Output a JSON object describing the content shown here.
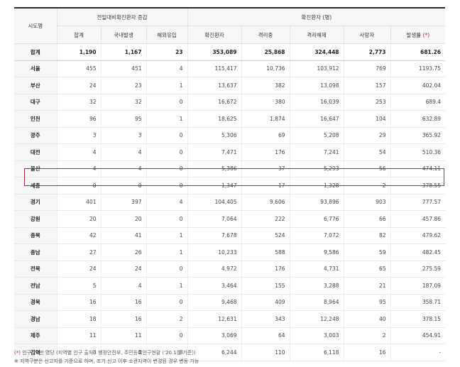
{
  "header": {
    "region_col": "시도명",
    "group_daily": "전일대비확진환자 증감",
    "group_confirmed": "확진환자 (명)",
    "daily_cols": [
      "합계",
      "국내발생",
      "해외유입"
    ],
    "confirmed_cols": [
      "확진환자",
      "격리중",
      "격리해제",
      "사망자"
    ],
    "incidence_col": "발생률",
    "incidence_mark": "(*)"
  },
  "rows": [
    {
      "region": "합계",
      "total": "1,190",
      "domestic": "1,167",
      "imported": "23",
      "confirmed": "353,089",
      "isolated": "25,868",
      "released": "324,448",
      "deaths": "2,773",
      "incidence": "681.26"
    },
    {
      "region": "서울",
      "total": "455",
      "domestic": "451",
      "imported": "4",
      "confirmed": "115,417",
      "isolated": "10,736",
      "released": "103,912",
      "deaths": "769",
      "incidence": "1193.75"
    },
    {
      "region": "부산",
      "total": "24",
      "domestic": "23",
      "imported": "1",
      "confirmed": "13,637",
      "isolated": "382",
      "released": "13,098",
      "deaths": "157",
      "incidence": "402.04"
    },
    {
      "region": "대구",
      "total": "32",
      "domestic": "32",
      "imported": "0",
      "confirmed": "16,672",
      "isolated": "380",
      "released": "16,039",
      "deaths": "253",
      "incidence": "689.4"
    },
    {
      "region": "인천",
      "total": "96",
      "domestic": "95",
      "imported": "1",
      "confirmed": "18,625",
      "isolated": "1,874",
      "released": "16,647",
      "deaths": "104",
      "incidence": "632.89"
    },
    {
      "region": "광주",
      "total": "3",
      "domestic": "3",
      "imported": "0",
      "confirmed": "5,306",
      "isolated": "69",
      "released": "5,208",
      "deaths": "29",
      "incidence": "365.92"
    },
    {
      "region": "대전",
      "total": "4",
      "domestic": "4",
      "imported": "0",
      "confirmed": "7,471",
      "isolated": "176",
      "released": "7,241",
      "deaths": "54",
      "incidence": "510.36"
    },
    {
      "region": "울산",
      "total": "4",
      "domestic": "4",
      "imported": "0",
      "confirmed": "5,386",
      "isolated": "37",
      "released": "5,293",
      "deaths": "56",
      "incidence": "474.11"
    },
    {
      "region": "세종",
      "total": "0",
      "domestic": "0",
      "imported": "0",
      "confirmed": "1,347",
      "isolated": "17",
      "released": "1,328",
      "deaths": "2",
      "incidence": "378.55"
    },
    {
      "region": "경기",
      "total": "401",
      "domestic": "397",
      "imported": "4",
      "confirmed": "104,405",
      "isolated": "9,606",
      "released": "93,896",
      "deaths": "903",
      "incidence": "777.57"
    },
    {
      "region": "강원",
      "total": "20",
      "domestic": "20",
      "imported": "0",
      "confirmed": "7,064",
      "isolated": "222",
      "released": "6,776",
      "deaths": "66",
      "incidence": "457.86"
    },
    {
      "region": "충북",
      "total": "42",
      "domestic": "41",
      "imported": "1",
      "confirmed": "7,678",
      "isolated": "524",
      "released": "7,072",
      "deaths": "82",
      "incidence": "479.62"
    },
    {
      "region": "충남",
      "total": "27",
      "domestic": "26",
      "imported": "1",
      "confirmed": "10,233",
      "isolated": "588",
      "released": "9,586",
      "deaths": "59",
      "incidence": "482.45"
    },
    {
      "region": "전북",
      "total": "24",
      "domestic": "24",
      "imported": "0",
      "confirmed": "4,972",
      "isolated": "176",
      "released": "4,731",
      "deaths": "65",
      "incidence": "275.59"
    },
    {
      "region": "전남",
      "total": "5",
      "domestic": "4",
      "imported": "1",
      "confirmed": "3,464",
      "isolated": "155",
      "released": "3,288",
      "deaths": "21",
      "incidence": "187.09"
    },
    {
      "region": "경북",
      "total": "16",
      "domestic": "16",
      "imported": "0",
      "confirmed": "9,468",
      "isolated": "409",
      "released": "8,964",
      "deaths": "95",
      "incidence": "358.71"
    },
    {
      "region": "경남",
      "total": "18",
      "domestic": "16",
      "imported": "2",
      "confirmed": "12,631",
      "isolated": "343",
      "released": "12,248",
      "deaths": "40",
      "incidence": "378.15"
    },
    {
      "region": "제주",
      "total": "11",
      "domestic": "11",
      "imported": "0",
      "confirmed": "3,069",
      "isolated": "64",
      "released": "3,003",
      "deaths": "2",
      "incidence": "454.91"
    },
    {
      "region": "검역",
      "total": "8",
      "domestic": "0",
      "imported": "8",
      "confirmed": "6,244",
      "isolated": "110",
      "released": "6,118",
      "deaths": "16",
      "incidence": "-"
    }
  ],
  "notes": {
    "mark": "(*)",
    "note1": " 인구 10만 명당 (지역별 인구 출처 : 행정안전부, 주민등록인구현황 ('20.1월 기준))",
    "note2": "※ 지역구분은 신고지를 기준으로 하며, 조기 신고 이후 소관지역이 변경된 경우 변동 가능"
  },
  "colors": {
    "highlight_border": "#c0272d",
    "incidence_mark": "#c8102e",
    "header_bg": "#f7f7f8"
  }
}
